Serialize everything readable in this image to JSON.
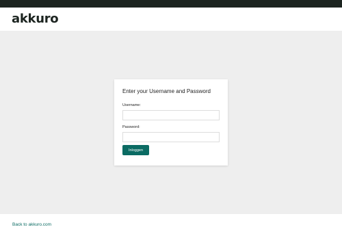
{
  "header": {
    "logo_text": "akkuro"
  },
  "login": {
    "title": "Enter your Username and Password",
    "username_label": "Username:",
    "username_value": "",
    "password_label": "Password:",
    "password_value": "",
    "submit_label": "Inloggen"
  },
  "footer": {
    "back_link": "Back to akkuro.com"
  },
  "colors": {
    "topbar": "#1c2420",
    "accent": "#0b6b63",
    "background": "#eeeeee"
  }
}
